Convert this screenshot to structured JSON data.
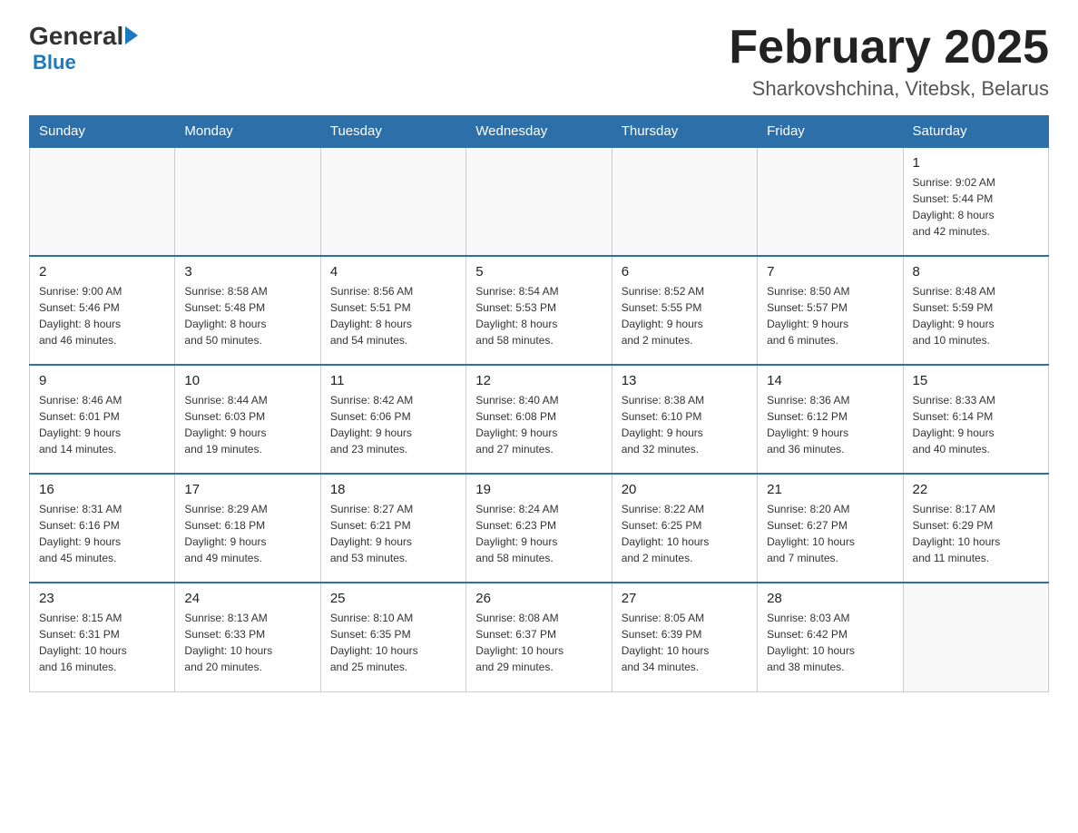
{
  "logo": {
    "general": "General",
    "blue": "Blue"
  },
  "title": "February 2025",
  "subtitle": "Sharkovshchina, Vitebsk, Belarus",
  "weekdays": [
    "Sunday",
    "Monday",
    "Tuesday",
    "Wednesday",
    "Thursday",
    "Friday",
    "Saturday"
  ],
  "weeks": [
    [
      {
        "day": "",
        "info": ""
      },
      {
        "day": "",
        "info": ""
      },
      {
        "day": "",
        "info": ""
      },
      {
        "day": "",
        "info": ""
      },
      {
        "day": "",
        "info": ""
      },
      {
        "day": "",
        "info": ""
      },
      {
        "day": "1",
        "info": "Sunrise: 9:02 AM\nSunset: 5:44 PM\nDaylight: 8 hours\nand 42 minutes."
      }
    ],
    [
      {
        "day": "2",
        "info": "Sunrise: 9:00 AM\nSunset: 5:46 PM\nDaylight: 8 hours\nand 46 minutes."
      },
      {
        "day": "3",
        "info": "Sunrise: 8:58 AM\nSunset: 5:48 PM\nDaylight: 8 hours\nand 50 minutes."
      },
      {
        "day": "4",
        "info": "Sunrise: 8:56 AM\nSunset: 5:51 PM\nDaylight: 8 hours\nand 54 minutes."
      },
      {
        "day": "5",
        "info": "Sunrise: 8:54 AM\nSunset: 5:53 PM\nDaylight: 8 hours\nand 58 minutes."
      },
      {
        "day": "6",
        "info": "Sunrise: 8:52 AM\nSunset: 5:55 PM\nDaylight: 9 hours\nand 2 minutes."
      },
      {
        "day": "7",
        "info": "Sunrise: 8:50 AM\nSunset: 5:57 PM\nDaylight: 9 hours\nand 6 minutes."
      },
      {
        "day": "8",
        "info": "Sunrise: 8:48 AM\nSunset: 5:59 PM\nDaylight: 9 hours\nand 10 minutes."
      }
    ],
    [
      {
        "day": "9",
        "info": "Sunrise: 8:46 AM\nSunset: 6:01 PM\nDaylight: 9 hours\nand 14 minutes."
      },
      {
        "day": "10",
        "info": "Sunrise: 8:44 AM\nSunset: 6:03 PM\nDaylight: 9 hours\nand 19 minutes."
      },
      {
        "day": "11",
        "info": "Sunrise: 8:42 AM\nSunset: 6:06 PM\nDaylight: 9 hours\nand 23 minutes."
      },
      {
        "day": "12",
        "info": "Sunrise: 8:40 AM\nSunset: 6:08 PM\nDaylight: 9 hours\nand 27 minutes."
      },
      {
        "day": "13",
        "info": "Sunrise: 8:38 AM\nSunset: 6:10 PM\nDaylight: 9 hours\nand 32 minutes."
      },
      {
        "day": "14",
        "info": "Sunrise: 8:36 AM\nSunset: 6:12 PM\nDaylight: 9 hours\nand 36 minutes."
      },
      {
        "day": "15",
        "info": "Sunrise: 8:33 AM\nSunset: 6:14 PM\nDaylight: 9 hours\nand 40 minutes."
      }
    ],
    [
      {
        "day": "16",
        "info": "Sunrise: 8:31 AM\nSunset: 6:16 PM\nDaylight: 9 hours\nand 45 minutes."
      },
      {
        "day": "17",
        "info": "Sunrise: 8:29 AM\nSunset: 6:18 PM\nDaylight: 9 hours\nand 49 minutes."
      },
      {
        "day": "18",
        "info": "Sunrise: 8:27 AM\nSunset: 6:21 PM\nDaylight: 9 hours\nand 53 minutes."
      },
      {
        "day": "19",
        "info": "Sunrise: 8:24 AM\nSunset: 6:23 PM\nDaylight: 9 hours\nand 58 minutes."
      },
      {
        "day": "20",
        "info": "Sunrise: 8:22 AM\nSunset: 6:25 PM\nDaylight: 10 hours\nand 2 minutes."
      },
      {
        "day": "21",
        "info": "Sunrise: 8:20 AM\nSunset: 6:27 PM\nDaylight: 10 hours\nand 7 minutes."
      },
      {
        "day": "22",
        "info": "Sunrise: 8:17 AM\nSunset: 6:29 PM\nDaylight: 10 hours\nand 11 minutes."
      }
    ],
    [
      {
        "day": "23",
        "info": "Sunrise: 8:15 AM\nSunset: 6:31 PM\nDaylight: 10 hours\nand 16 minutes."
      },
      {
        "day": "24",
        "info": "Sunrise: 8:13 AM\nSunset: 6:33 PM\nDaylight: 10 hours\nand 20 minutes."
      },
      {
        "day": "25",
        "info": "Sunrise: 8:10 AM\nSunset: 6:35 PM\nDaylight: 10 hours\nand 25 minutes."
      },
      {
        "day": "26",
        "info": "Sunrise: 8:08 AM\nSunset: 6:37 PM\nDaylight: 10 hours\nand 29 minutes."
      },
      {
        "day": "27",
        "info": "Sunrise: 8:05 AM\nSunset: 6:39 PM\nDaylight: 10 hours\nand 34 minutes."
      },
      {
        "day": "28",
        "info": "Sunrise: 8:03 AM\nSunset: 6:42 PM\nDaylight: 10 hours\nand 38 minutes."
      },
      {
        "day": "",
        "info": ""
      }
    ]
  ]
}
